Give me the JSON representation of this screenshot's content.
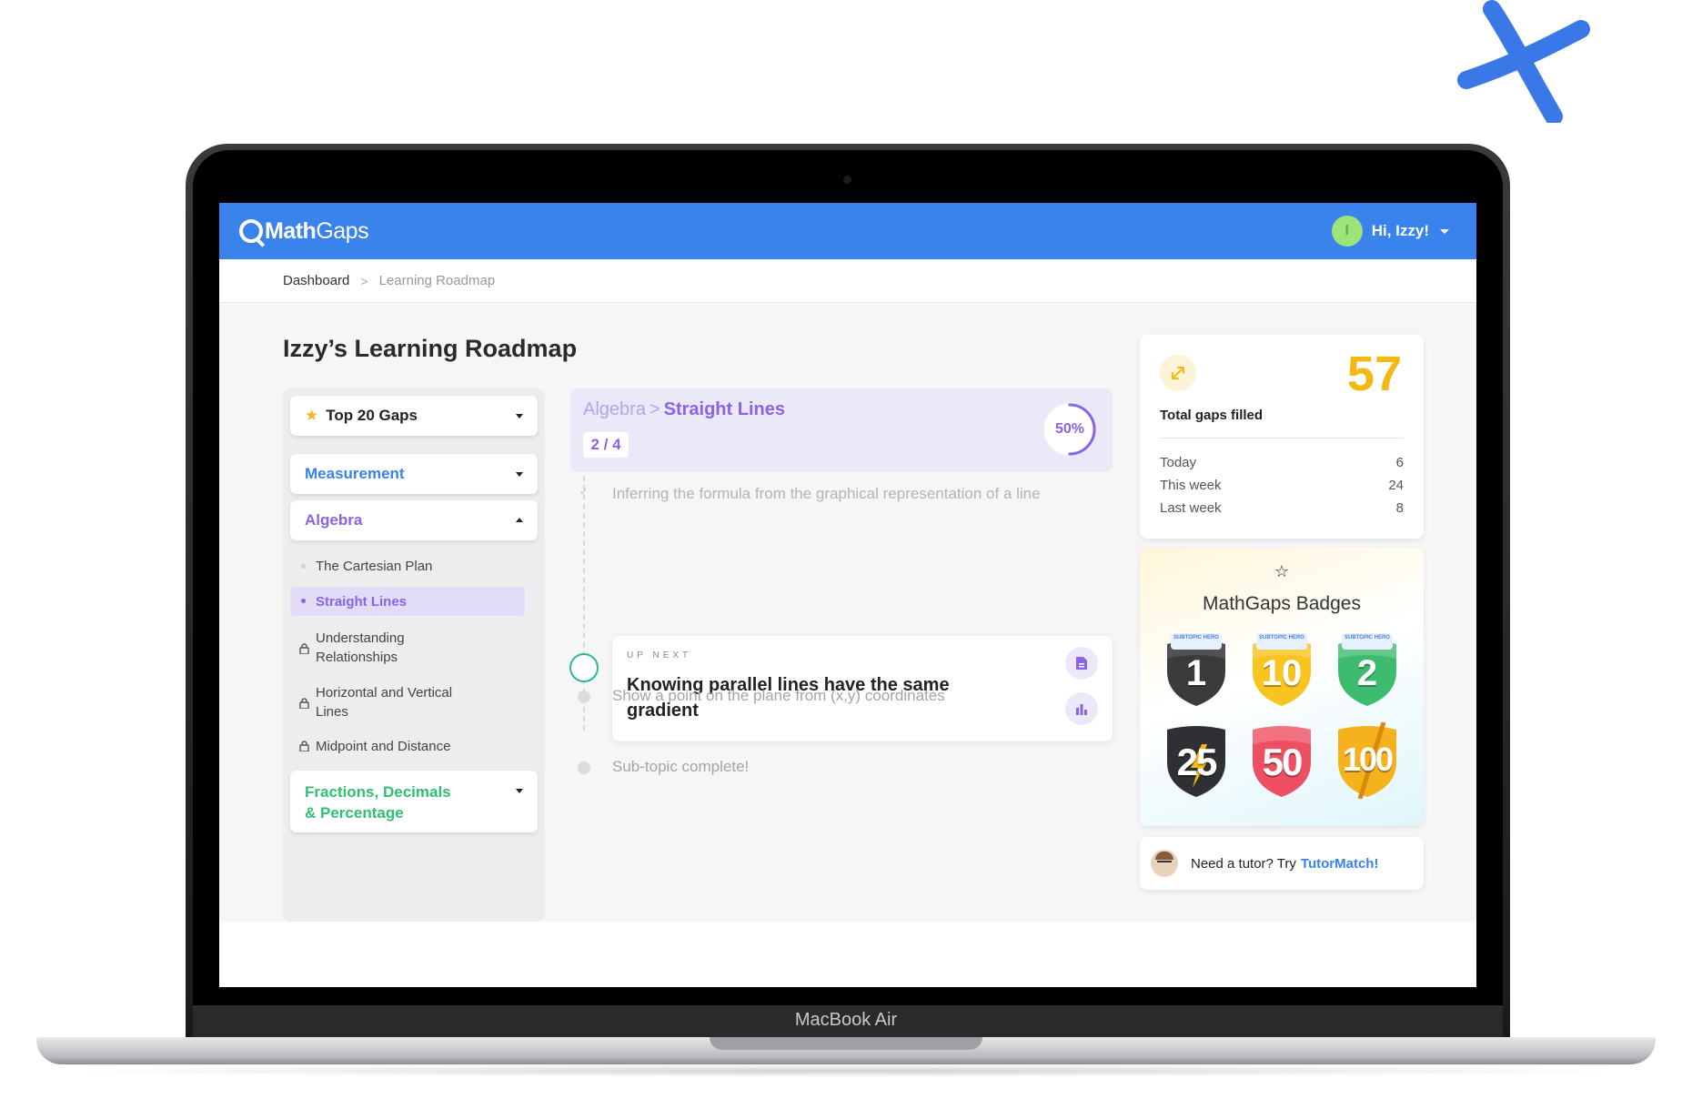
{
  "device": {
    "label": "MacBook Air"
  },
  "header": {
    "logo_bold": "Math",
    "logo_rest": "Gaps",
    "avatar_initial": "I",
    "greeting": "Hi, Izzy!"
  },
  "breadcrumb": {
    "items": [
      "Dashboard",
      "Learning Roadmap"
    ],
    "separator": ">"
  },
  "page": {
    "title": "Izzy’s Learning Roadmap"
  },
  "sidebar": {
    "top_gaps": {
      "label": "Top 20 Gaps",
      "icon": "star-icon",
      "color": "#f5b52e"
    },
    "topics": [
      {
        "label": "Measurement",
        "color": "#3a82ec",
        "expanded": false
      },
      {
        "label": "Algebra",
        "color": "#8a63e6",
        "expanded": true
      },
      {
        "label": "Fractions, Decimals & Percentage",
        "line1": "Fractions, Decimals",
        "line2": "& Percentage",
        "color": "#2fbf71",
        "expanded": false
      }
    ],
    "subtopics": [
      {
        "label": "The Cartesian Plan",
        "state": "available"
      },
      {
        "label": "Straight Lines",
        "state": "active"
      },
      {
        "label": "Understanding Relationships",
        "line1": "Understanding",
        "line2": "Relationships",
        "state": "locked"
      },
      {
        "label": "Horizontal and Vertical Lines",
        "line1": "Horizontal and Vertical",
        "line2": "Lines",
        "state": "locked"
      },
      {
        "label": "Midpoint and Distance",
        "state": "locked"
      }
    ]
  },
  "roadmap": {
    "crumb_topic": "Algebra",
    "crumb_sep": ">",
    "crumb_subtopic": "Straight Lines",
    "progress_count": "2 / 4",
    "progress_percent": "50%",
    "progress_fraction": 0.5,
    "completed_step": "Inferring the formula from the graphical representation of a line",
    "up_next_label": "UP NEXT",
    "up_next_title": "Knowing parallel lines have the same gradient",
    "next_steps": [
      "Show a point on the plane from (x,y) coordinates",
      "Sub-topic complete!"
    ],
    "actions": [
      "document-icon",
      "chart-icon"
    ]
  },
  "stats": {
    "total": "57",
    "caption": "Total gaps filled",
    "rows": [
      {
        "label": "Today",
        "value": "6"
      },
      {
        "label": "This week",
        "value": "24"
      },
      {
        "label": "Last week",
        "value": "8"
      }
    ]
  },
  "badges": {
    "title": "MathGaps Badges",
    "subtopic_tag": "SUBTOPIC HERO",
    "items": [
      "1",
      "10",
      "2",
      "25",
      "50",
      "100"
    ]
  },
  "tutor": {
    "text": "Need a tutor? Try",
    "link": "TutorMatch!"
  },
  "colors": {
    "brand": "#3a82ec",
    "purple": "#8a63e6",
    "gold": "#f3b811",
    "green": "#2fbf71"
  }
}
